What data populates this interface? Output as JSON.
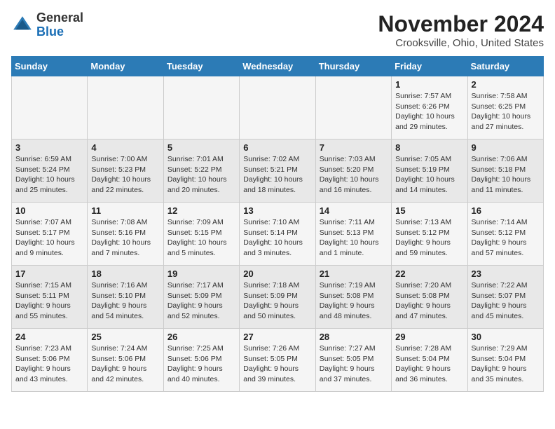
{
  "header": {
    "logo_line1": "General",
    "logo_line2": "Blue",
    "month": "November 2024",
    "location": "Crooksville, Ohio, United States"
  },
  "weekdays": [
    "Sunday",
    "Monday",
    "Tuesday",
    "Wednesday",
    "Thursday",
    "Friday",
    "Saturday"
  ],
  "weeks": [
    [
      {
        "day": "",
        "info": ""
      },
      {
        "day": "",
        "info": ""
      },
      {
        "day": "",
        "info": ""
      },
      {
        "day": "",
        "info": ""
      },
      {
        "day": "",
        "info": ""
      },
      {
        "day": "1",
        "info": "Sunrise: 7:57 AM\nSunset: 6:26 PM\nDaylight: 10 hours and 29 minutes."
      },
      {
        "day": "2",
        "info": "Sunrise: 7:58 AM\nSunset: 6:25 PM\nDaylight: 10 hours and 27 minutes."
      }
    ],
    [
      {
        "day": "3",
        "info": "Sunrise: 6:59 AM\nSunset: 5:24 PM\nDaylight: 10 hours and 25 minutes."
      },
      {
        "day": "4",
        "info": "Sunrise: 7:00 AM\nSunset: 5:23 PM\nDaylight: 10 hours and 22 minutes."
      },
      {
        "day": "5",
        "info": "Sunrise: 7:01 AM\nSunset: 5:22 PM\nDaylight: 10 hours and 20 minutes."
      },
      {
        "day": "6",
        "info": "Sunrise: 7:02 AM\nSunset: 5:21 PM\nDaylight: 10 hours and 18 minutes."
      },
      {
        "day": "7",
        "info": "Sunrise: 7:03 AM\nSunset: 5:20 PM\nDaylight: 10 hours and 16 minutes."
      },
      {
        "day": "8",
        "info": "Sunrise: 7:05 AM\nSunset: 5:19 PM\nDaylight: 10 hours and 14 minutes."
      },
      {
        "day": "9",
        "info": "Sunrise: 7:06 AM\nSunset: 5:18 PM\nDaylight: 10 hours and 11 minutes."
      }
    ],
    [
      {
        "day": "10",
        "info": "Sunrise: 7:07 AM\nSunset: 5:17 PM\nDaylight: 10 hours and 9 minutes."
      },
      {
        "day": "11",
        "info": "Sunrise: 7:08 AM\nSunset: 5:16 PM\nDaylight: 10 hours and 7 minutes."
      },
      {
        "day": "12",
        "info": "Sunrise: 7:09 AM\nSunset: 5:15 PM\nDaylight: 10 hours and 5 minutes."
      },
      {
        "day": "13",
        "info": "Sunrise: 7:10 AM\nSunset: 5:14 PM\nDaylight: 10 hours and 3 minutes."
      },
      {
        "day": "14",
        "info": "Sunrise: 7:11 AM\nSunset: 5:13 PM\nDaylight: 10 hours and 1 minute."
      },
      {
        "day": "15",
        "info": "Sunrise: 7:13 AM\nSunset: 5:12 PM\nDaylight: 9 hours and 59 minutes."
      },
      {
        "day": "16",
        "info": "Sunrise: 7:14 AM\nSunset: 5:12 PM\nDaylight: 9 hours and 57 minutes."
      }
    ],
    [
      {
        "day": "17",
        "info": "Sunrise: 7:15 AM\nSunset: 5:11 PM\nDaylight: 9 hours and 55 minutes."
      },
      {
        "day": "18",
        "info": "Sunrise: 7:16 AM\nSunset: 5:10 PM\nDaylight: 9 hours and 54 minutes."
      },
      {
        "day": "19",
        "info": "Sunrise: 7:17 AM\nSunset: 5:09 PM\nDaylight: 9 hours and 52 minutes."
      },
      {
        "day": "20",
        "info": "Sunrise: 7:18 AM\nSunset: 5:09 PM\nDaylight: 9 hours and 50 minutes."
      },
      {
        "day": "21",
        "info": "Sunrise: 7:19 AM\nSunset: 5:08 PM\nDaylight: 9 hours and 48 minutes."
      },
      {
        "day": "22",
        "info": "Sunrise: 7:20 AM\nSunset: 5:08 PM\nDaylight: 9 hours and 47 minutes."
      },
      {
        "day": "23",
        "info": "Sunrise: 7:22 AM\nSunset: 5:07 PM\nDaylight: 9 hours and 45 minutes."
      }
    ],
    [
      {
        "day": "24",
        "info": "Sunrise: 7:23 AM\nSunset: 5:06 PM\nDaylight: 9 hours and 43 minutes."
      },
      {
        "day": "25",
        "info": "Sunrise: 7:24 AM\nSunset: 5:06 PM\nDaylight: 9 hours and 42 minutes."
      },
      {
        "day": "26",
        "info": "Sunrise: 7:25 AM\nSunset: 5:06 PM\nDaylight: 9 hours and 40 minutes."
      },
      {
        "day": "27",
        "info": "Sunrise: 7:26 AM\nSunset: 5:05 PM\nDaylight: 9 hours and 39 minutes."
      },
      {
        "day": "28",
        "info": "Sunrise: 7:27 AM\nSunset: 5:05 PM\nDaylight: 9 hours and 37 minutes."
      },
      {
        "day": "29",
        "info": "Sunrise: 7:28 AM\nSunset: 5:04 PM\nDaylight: 9 hours and 36 minutes."
      },
      {
        "day": "30",
        "info": "Sunrise: 7:29 AM\nSunset: 5:04 PM\nDaylight: 9 hours and 35 minutes."
      }
    ]
  ]
}
